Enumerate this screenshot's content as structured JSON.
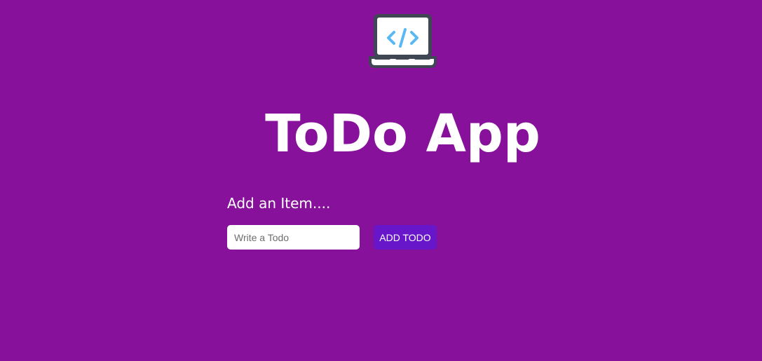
{
  "header": {
    "logo_icon": "laptop-code-icon",
    "title": "ToDo App"
  },
  "form": {
    "heading": "Add an Item....",
    "input_value": "",
    "input_placeholder": "Write a Todo",
    "button_label": "ADD TODO"
  },
  "colors": {
    "background": "#87119a",
    "button": "#6716c9",
    "text": "#ffffff",
    "logo_code": "#5ab8f4",
    "logo_frame": "#3f4754"
  }
}
